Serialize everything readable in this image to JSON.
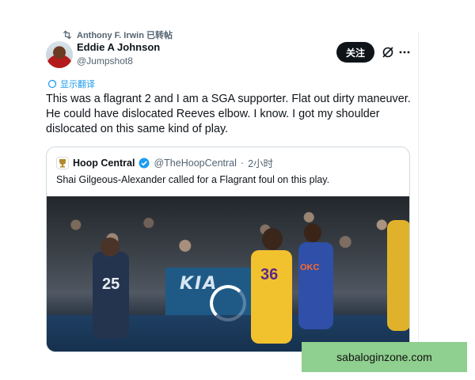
{
  "repost": {
    "text": "Anthony F. Irwin 已转帖",
    "icon": "retweet-icon"
  },
  "author": {
    "name": "Eddie A Johnson",
    "handle": "@Jumpshot8"
  },
  "actions": {
    "follow_label": "关注",
    "grok_icon": "grok-icon",
    "more_icon": "more-icon"
  },
  "translate_label": "显示翻译",
  "tweet_lines": [
    "This was a flagrant 2 and I am a SGA supporter. Flat out dirty maneuver.",
    "He could have dislocated Reeves elbow.  I know. I got my shoulder",
    "dislocated on this same kind of play."
  ],
  "quote": {
    "name": "Hoop Central",
    "handle": "@TheHoopCentral",
    "time": "2小时",
    "separator": "·",
    "text": "Shai Gilgeous-Alexander called for a Flagrant foul on this play.",
    "media": {
      "jersey_left": "25",
      "jersey_gold": "36",
      "jersey_okc": "OKC",
      "court_logo": "KIA"
    }
  },
  "watermark": "sabaloginzone.com",
  "colors": {
    "link": "#1d9bf0",
    "follow_bg": "#0f1419",
    "verified": "#1d9bf0"
  }
}
